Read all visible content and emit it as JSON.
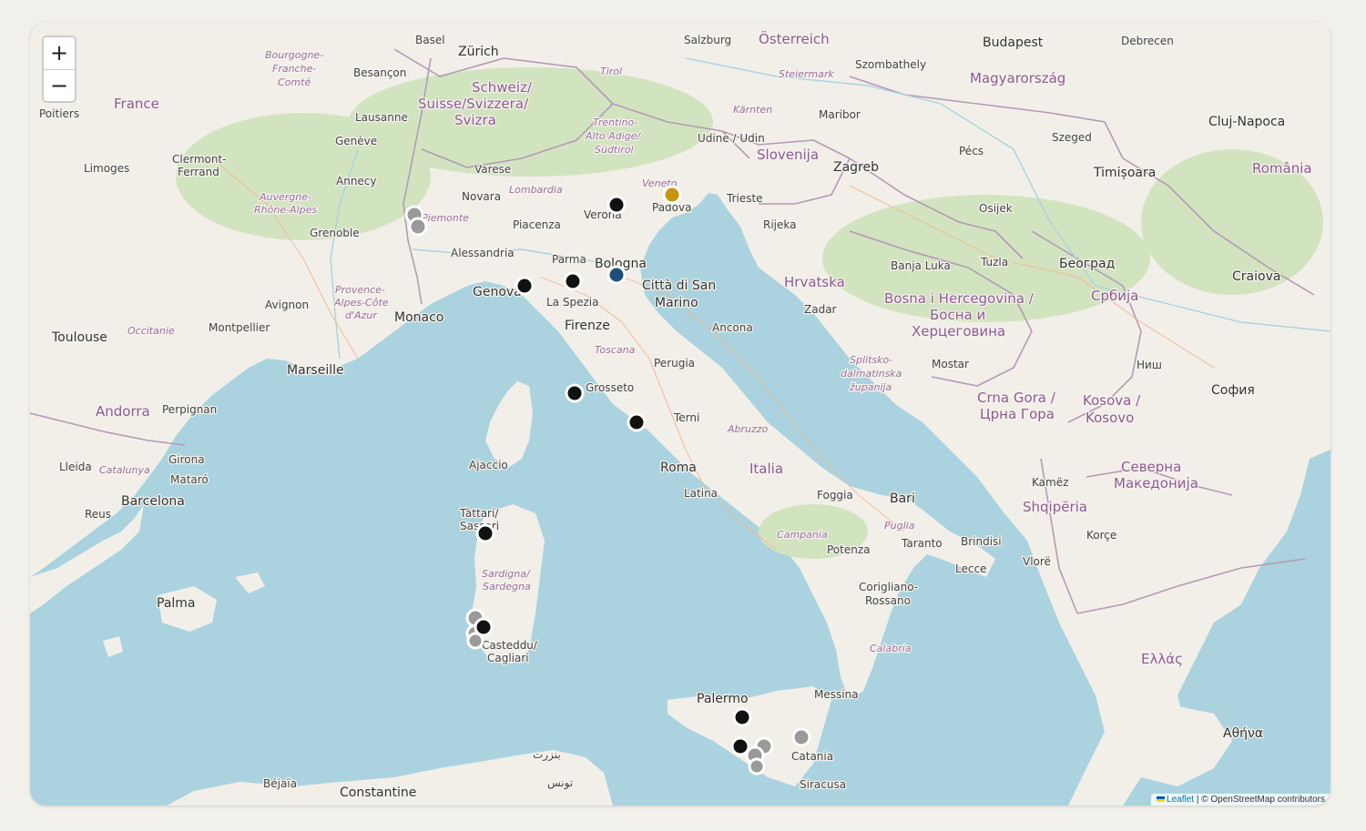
{
  "map": {
    "zoom_in_label": "+",
    "zoom_out_label": "−",
    "attribution": {
      "leaflet": "Leaflet",
      "separator": " | ",
      "osm": "© OpenStreetMap contributors"
    },
    "colors": {
      "water": "#aad3df",
      "land": "#f2efe9",
      "border": "#b49ab5",
      "marker_black": "#111111",
      "marker_grey": "#9a9a9a",
      "marker_blue": "#1f4e79",
      "marker_gold": "#c8950f"
    },
    "labels": {
      "france": "France",
      "schweiz": "Schweiz/ Suisse/Svizzera/ Svizra",
      "osterreich": "Österreich",
      "magyarorszag": "Magyarország",
      "slovenija": "Slovenija",
      "hrvatska": "Hrvatska",
      "romania": "România",
      "srbija": "Србија",
      "bosna": "Bosna i Hercegovina / Босна и Херцеговина",
      "crna_gora": "Crna Gora / Црна Гора",
      "kosova": "Kosova / Kosovo",
      "shqiperia": "Shqipëria",
      "severna": "Северна Македонија",
      "ellas": "Ελλάς",
      "italia": "Italia",
      "andorra": "Andorra",
      "monaco": "Monaco",
      "citta": "Città di San Marino",
      "lombardia": "Lombardia",
      "veneto": "Veneto",
      "piemonte": "Piemonte",
      "toscana": "Toscana",
      "sardigna": "Sardigna/ Sardegna",
      "campania": "Campania",
      "puglia": "Puglia",
      "calabria": "Calabria",
      "abruzzo": "Abruzzo",
      "occitanie": "Occitanie",
      "provence": "Provence-Alpes-Côte d'Azur",
      "auvergne": "Auvergne-Rhône-Alpes",
      "bourgogne": "Bourgogne-Franche-Comté",
      "catalunya": "Catalunya",
      "tirol": "Tirol",
      "trentino": "Trentino-Alto Adige/ Südtirol",
      "karnten": "Kärnten",
      "steiermark": "Steiermark",
      "zurich": "Zürich",
      "basel": "Basel",
      "salzburg": "Salzburg",
      "budapest": "Budapest",
      "zagreb": "Zagreb",
      "beograd": "Београд",
      "sofia": "София",
      "marseille": "Marseille",
      "toulouse": "Toulouse",
      "barcelona": "Barcelona",
      "palma": "Palma",
      "genova": "Genova",
      "bologna": "Bologna",
      "firenze": "Firenze",
      "roma": "Roma",
      "bari": "Bari",
      "palermo": "Palermo",
      "catania": "Catania",
      "cagliari": "Casteddu/ Cagliari",
      "sassari": "Tàttari/ Sassari",
      "ajaccio": "Ajaccio",
      "verona": "Verona",
      "padova": "Padova",
      "trieste": "Trieste",
      "rijeka": "Rijeka",
      "milano": "Novara",
      "piacenza": "Piacenza",
      "parma": "Parma",
      "la_spezia": "La Spezia",
      "grosseto": "Grosseto",
      "perugia": "Perugia",
      "ancona": "Ancona",
      "terni": "Terni",
      "latina": "Latina",
      "foggia": "Foggia",
      "taranto": "Taranto",
      "brindisi": "Brindisi",
      "lecce": "Lecce",
      "potenza": "Potenza",
      "messina": "Messina",
      "siracusa": "Siracusa",
      "reggio": "Corigliano-Rossano",
      "nice": "Avignon",
      "montpellier": "Montpellier",
      "grenoble": "Grenoble",
      "lyon": "Clermont-Ferrand",
      "geneve": "Genève",
      "lausanne": "Lausanne",
      "bern": "Besançon",
      "annecy": "Annecy",
      "limoges": "Limoges",
      "poitiers": "Poitiers",
      "perpignan": "Perpignan",
      "girona": "Girona",
      "lleida": "Lleida",
      "reus": "Reus",
      "mataro": "Mataró",
      "alessandria": "Alessandria",
      "varese": "Varese",
      "udine": "Udine / Udin",
      "maribor": "Maribor",
      "graz": "Szombathely",
      "pecs": "Pécs",
      "szeged": "Szeged",
      "osijek": "Osijek",
      "banja_luka": "Banja Luka",
      "tuzla": "Tuzla",
      "zadar": "Zadar",
      "split": "Splitsko-dalmatinska županija",
      "mostar": "Mostar",
      "timisoara": "Timișoara",
      "cluj": "Cluj-Napoca",
      "craiova": "Craiova",
      "nis": "Ниш",
      "skopje": "Korçe",
      "vlore": "Vlorë",
      "tirana": "Kamëz",
      "athina": "Αθήνα",
      "constantine": "Constantine",
      "bejaia": "Béjaïa",
      "tunis": "تونس",
      "bizerte": "بنزرت",
      "lodz": "Debrecen"
    }
  }
}
